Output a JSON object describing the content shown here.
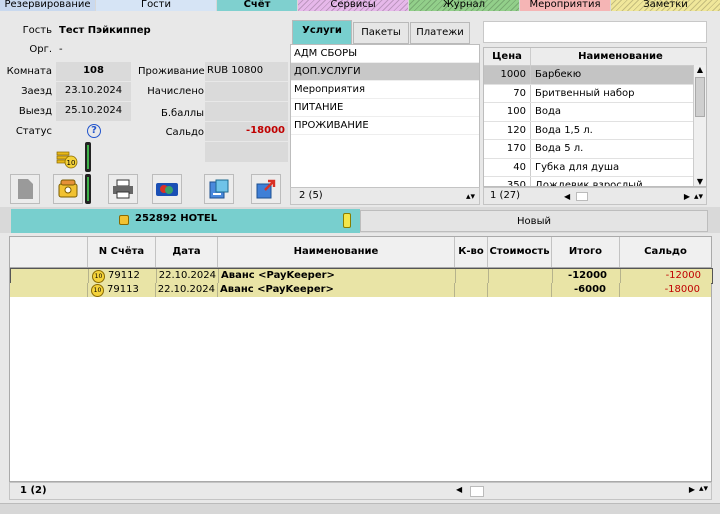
{
  "top_tabs": [
    {
      "label": "Резервирование"
    },
    {
      "label": "Гости"
    },
    {
      "label": "Счёт"
    },
    {
      "label": "Сервисы"
    },
    {
      "label": "Журнал"
    },
    {
      "label": "Мероприятия"
    },
    {
      "label": "Заметки"
    }
  ],
  "guest": {
    "guest_label": "Гость",
    "guest_value": "Тест Пэйкиппер",
    "org_label": "Орг.",
    "org_value": "-",
    "room_label": "Комната",
    "room_value": "108",
    "stay_label": "Проживание",
    "stay_value": "RUB 10800",
    "arrival_label": "Заезд",
    "arrival_value": "23.10.2024",
    "accrued_label": "Начислено",
    "departure_label": "Выезд",
    "departure_value": "25.10.2024",
    "bonus_label": "Б.баллы",
    "status_label": "Статус",
    "status_value": "?",
    "balance_label": "Сальдо",
    "balance_value": "-18000"
  },
  "service_tabs": [
    {
      "label": "Услуги"
    },
    {
      "label": "Пакеты"
    },
    {
      "label": "Платежи"
    }
  ],
  "services": [
    "АДМ СБОРЫ",
    "ДОП.УСЛУГИ",
    "Мероприятия",
    "ПИТАНИЕ",
    "ПРОЖИВАНИЕ"
  ],
  "services_count": "2 (5)",
  "price_grid": {
    "search_placeholder": "",
    "headers": {
      "price": "Цена",
      "name": "Наименование"
    },
    "rows": [
      {
        "price": "1000",
        "name": "Барбекю"
      },
      {
        "price": "70",
        "name": "Бритвенный набор"
      },
      {
        "price": "100",
        "name": "Вода"
      },
      {
        "price": "120",
        "name": "Вода 1,5 л."
      },
      {
        "price": "170",
        "name": "Вода 5 л."
      },
      {
        "price": "40",
        "name": "Губка для душа"
      },
      {
        "price": "350",
        "name": "Дождевик взрослый"
      }
    ],
    "count": "1 (27)"
  },
  "account_tabs": {
    "active_label": "252892  HOTEL",
    "new_label": "Новый"
  },
  "grid": {
    "headers": [
      "",
      "N Счёта",
      "Дата",
      "Наименование",
      "К-во",
      "Стоимость",
      "Итого",
      "Сальдо"
    ],
    "rows": [
      {
        "badge": "10",
        "number": "79112",
        "date": "22.10.2024",
        "name": "Аванс <PayKeeper>",
        "qty": "",
        "cost": "",
        "total": "-12000",
        "balance": "-12000"
      },
      {
        "badge": "10",
        "number": "79113",
        "date": "22.10.2024",
        "name": "Аванс <PayKeeper>",
        "qty": "",
        "cost": "",
        "total": "-6000",
        "balance": "-18000"
      }
    ],
    "count": "1 (2)"
  },
  "colors": {
    "accent": "#78cfce",
    "row_bg": "#e9e4a6",
    "negative": "#c00000"
  }
}
